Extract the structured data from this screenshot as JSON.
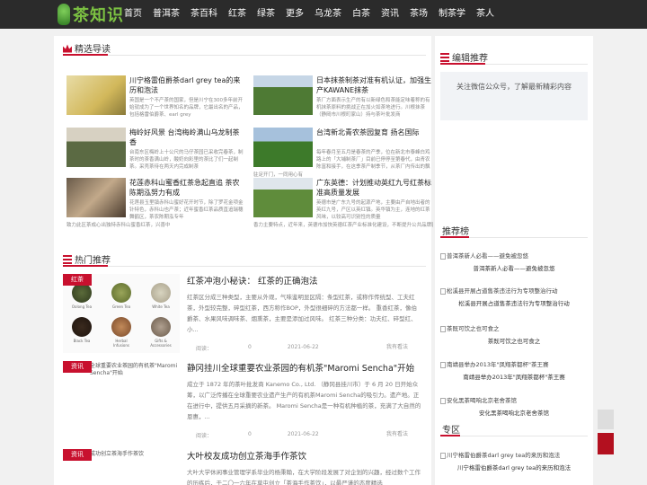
{
  "header": {
    "logo_text": "茶知识",
    "nav": [
      "首页",
      "普洱茶",
      "茶百科",
      "红茶",
      "绿茶",
      "更多",
      "乌龙茶",
      "白茶",
      "资讯",
      "茶场",
      "制茶学",
      "茶人"
    ]
  },
  "featured": {
    "title": "精选导读",
    "cards": [
      {
        "title": "川宁格雷伯爵茶darl grey tea的来历和泡法",
        "excerpt": "英国是一个不产茶的国家，但是川宁在300多年前开始就成为了一个世界知名的品牌，它最出名的产品，包括格雷伯爵茶、earl grey",
        "excerpt2": ""
      },
      {
        "title": "日本抹茶制茶对准有机认证，加强生产KAWANE抹茶",
        "excerpt": "茶厂方面表示生产的有以新绿色和茶能定味着称的有机抹茶原料的挑战正在加火如茶地进行。川根抹茶（静岡市川根町家山）持与茶叶批发商",
        "excerpt2": ""
      },
      {
        "title": "梅岭好风景 台湾梅岭满山乌龙制茶香",
        "excerpt": "台南东区梅岭上十公尺的马仔茶园已采收完春茶，制茶时的茶香满山岭，酸奶向彩里的茶比了们一起制茶。采壳茶待在两天内完成制茶",
        "excerpt2": ""
      },
      {
        "title": "台湾新北青农茶园复育 扬名国际",
        "excerpt": "每年春月至五月是春茶的产季，位在新北市泰峰白鸡路上的「大埔制茶厂」目前已停停至第春代，由青农陈富和接手，在这季茶产制季节，从茶厂内传出的飘郁茶香，吸引不少过客",
        "excerpt2": "驻足开门，一同用心有"
      },
      {
        "title": "花莲赤科山蜜香红茶急起直追 茶农陈期泓努力有成",
        "excerpt": "花莲县玉里镇赤科山蜜好花开时节，除了罗花金项金针特色，赤科山也产茶；近年蜜香红茶品质直追瑞穗舞鹤区，茶农陈期泓专年",
        "excerpt2": "致力此区茶成心出独特赤科山蜜香红茶，兴喜中"
      },
      {
        "title": "广东英德：计划推动英红九号红茶标准高质量发展",
        "excerpt": "英德市是广东九号的起源产地，主要由产自地出者的英红九号，产区以英红镇。英华镇为主，连地的红茶风味，以较高可识别性的质量",
        "excerpt2": "香力主要特点，近年来，英德市加快英德红茶产业标准化建设，不断提升公共品牌影响力，逐"
      }
    ]
  },
  "hot": {
    "title": "热门推荐",
    "items": [
      {
        "tag": "红茶",
        "title": "红茶冲泡小秘诀： 红茶的正确泡法",
        "excerpt": "红茶区分成三种类型，主要从外观，气味鉴明显区隔：条型红茶，或称作传统型、工夫红茶，外型较完整，碎型红茶，西方称作BOP，外型很细碎的方法都一样。 重香红茶，像伯爵茶、水果风味调味茶、烟熏茶，主要是添加过风味。 红茶三种分类：功夫红、碎型红、小...",
        "reads_label": "阅读：",
        "reads": "0",
        "date": "2021-06-22",
        "more": "我有看法",
        "alt": ""
      },
      {
        "tag": "资讯",
        "title": "静冈挂川全球重要农业茶园的有机茶\"Maromi Sencha\"开始",
        "excerpt": "成立于 1872 年的茶叶批发商 Kanemo Co., Ltd. （静冈县挂川市）于 6 月 20 日开始众筹，以广泛传播在全球重要农业遗产生产的有机茶Maromi Sencha的吸引力。遗产地。正在进行中，提供五月采摘的新茶。 Maromi Sencha是一种有机种植的茶，充满了大自然的恩惠，...",
        "reads_label": "阅读：",
        "reads": "0",
        "date": "2021-06-22",
        "more": "我有看法",
        "alt": "全球重要农业茶园的有机茶\"Maromi Sencha\"开始"
      },
      {
        "tag": "资讯",
        "title": "大叶校友成功创立茶海手作茶饮",
        "excerpt": "大叶大学休闲事业管理学系毕业的杨秉翰，在大学阶段发展了对企划的兴趣，经过数个工作的历练后，于二〇一六年在草屯创立「茶海手作茶饮」，以最严谨的态度精选",
        "reads_label": "阅读：",
        "reads": "0",
        "date": "",
        "more": "",
        "alt": "成功创立茶海手作茶饮"
      }
    ],
    "tea_labels": [
      "Oolong Tea",
      "Green Tea",
      "White Tea",
      "Black Tea",
      "Herbal Infusions",
      "Gifts & Accessories"
    ]
  },
  "side": {
    "editor_title": "编辑推荐",
    "follow_text": "关注微信公众号，了解最新精彩内容",
    "rank_title": "推荐榜",
    "rank": [
      {
        "alt": "普洱茶新人必看——避免被忽悠",
        "cap": "普洱茶新人必看——避免被忽悠"
      },
      {
        "alt": "松溪县开展占道售茶违法行为专项整治行动",
        "cap": "松溪县开展占道售茶违法行为专项整治行动"
      },
      {
        "alt": "茶既可饮之也可食之",
        "cap": "茶既可饮之也可食之"
      },
      {
        "alt": "南靖县举办2013年\"凤翔茶都杯\"茶王赛",
        "cap": "南靖县举办2013年\"凤翔茶都杯\"茶王赛"
      },
      {
        "alt": "安化黑茶喝响北京老舍茶馆",
        "cap": "安化黑茶喝响北京老舍茶馆"
      }
    ],
    "zone_title": "专区",
    "zone": [
      {
        "alt": "川宁格雷伯爵茶darl grey tea的来历和泡法",
        "cap": "川宁格雷伯爵茶darl grey tea的来历和泡法"
      }
    ]
  },
  "colors": {
    "accent": "#c8102e",
    "header_bg": "#2b2b2b",
    "logo_green": "#7cc242"
  }
}
